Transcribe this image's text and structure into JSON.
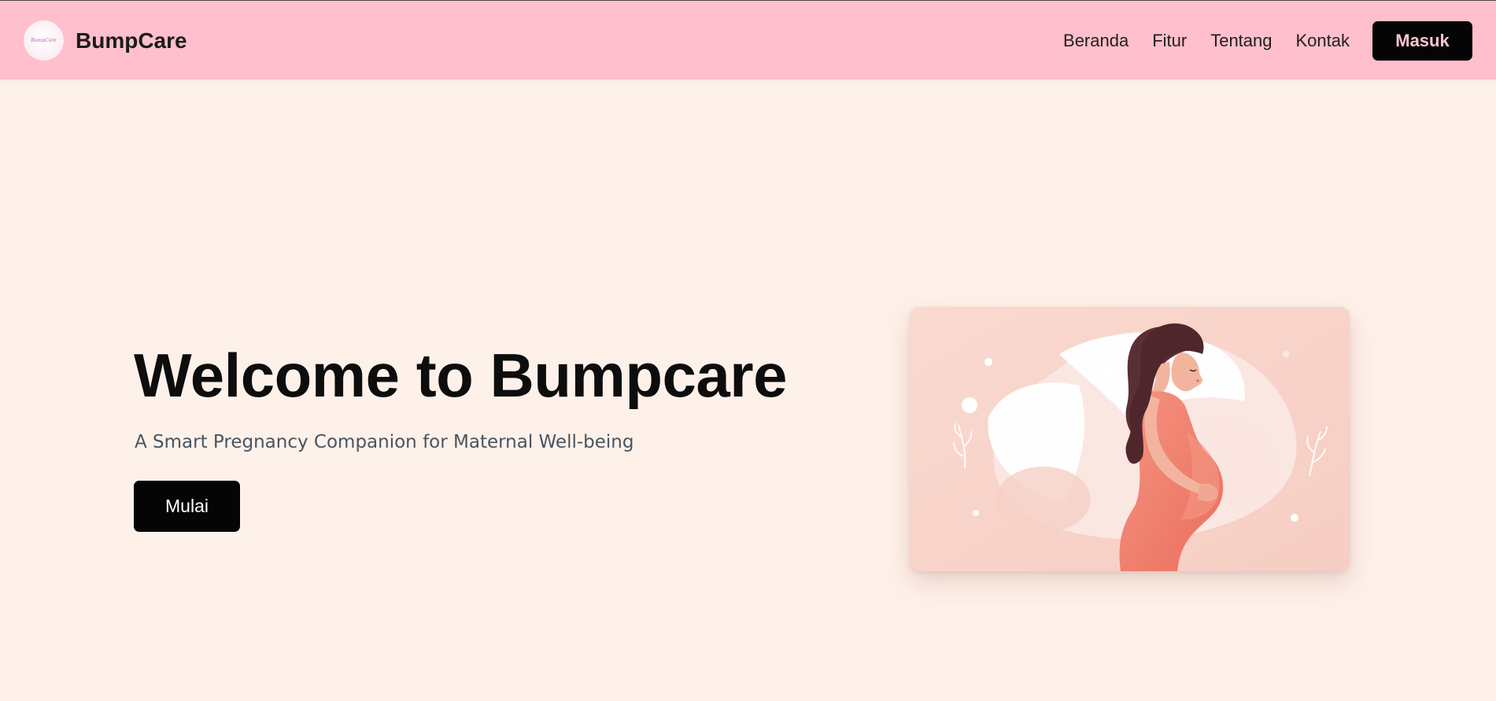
{
  "brand": {
    "name": "BumpCare",
    "logo_text": "BumpCare",
    "logo_icon": "bumpcare-logo-icon"
  },
  "nav": {
    "links": [
      "Beranda",
      "Fitur",
      "Tentang",
      "Kontak"
    ],
    "login_label": "Masuk"
  },
  "hero": {
    "title": "Welcome to Bumpcare",
    "subtitle": "A Smart Pregnancy Companion for Maternal Well-being",
    "cta_label": "Mulai",
    "illustration": "pregnant-woman-illustration"
  },
  "colors": {
    "navbar_bg": "#ffbfcc",
    "page_bg": "#fef1e9",
    "button_bg": "#050505",
    "login_text": "#ffc4d1",
    "dress": "#f07d6b",
    "hair": "#5a2f34",
    "card_bg": "#f8d6cd"
  }
}
